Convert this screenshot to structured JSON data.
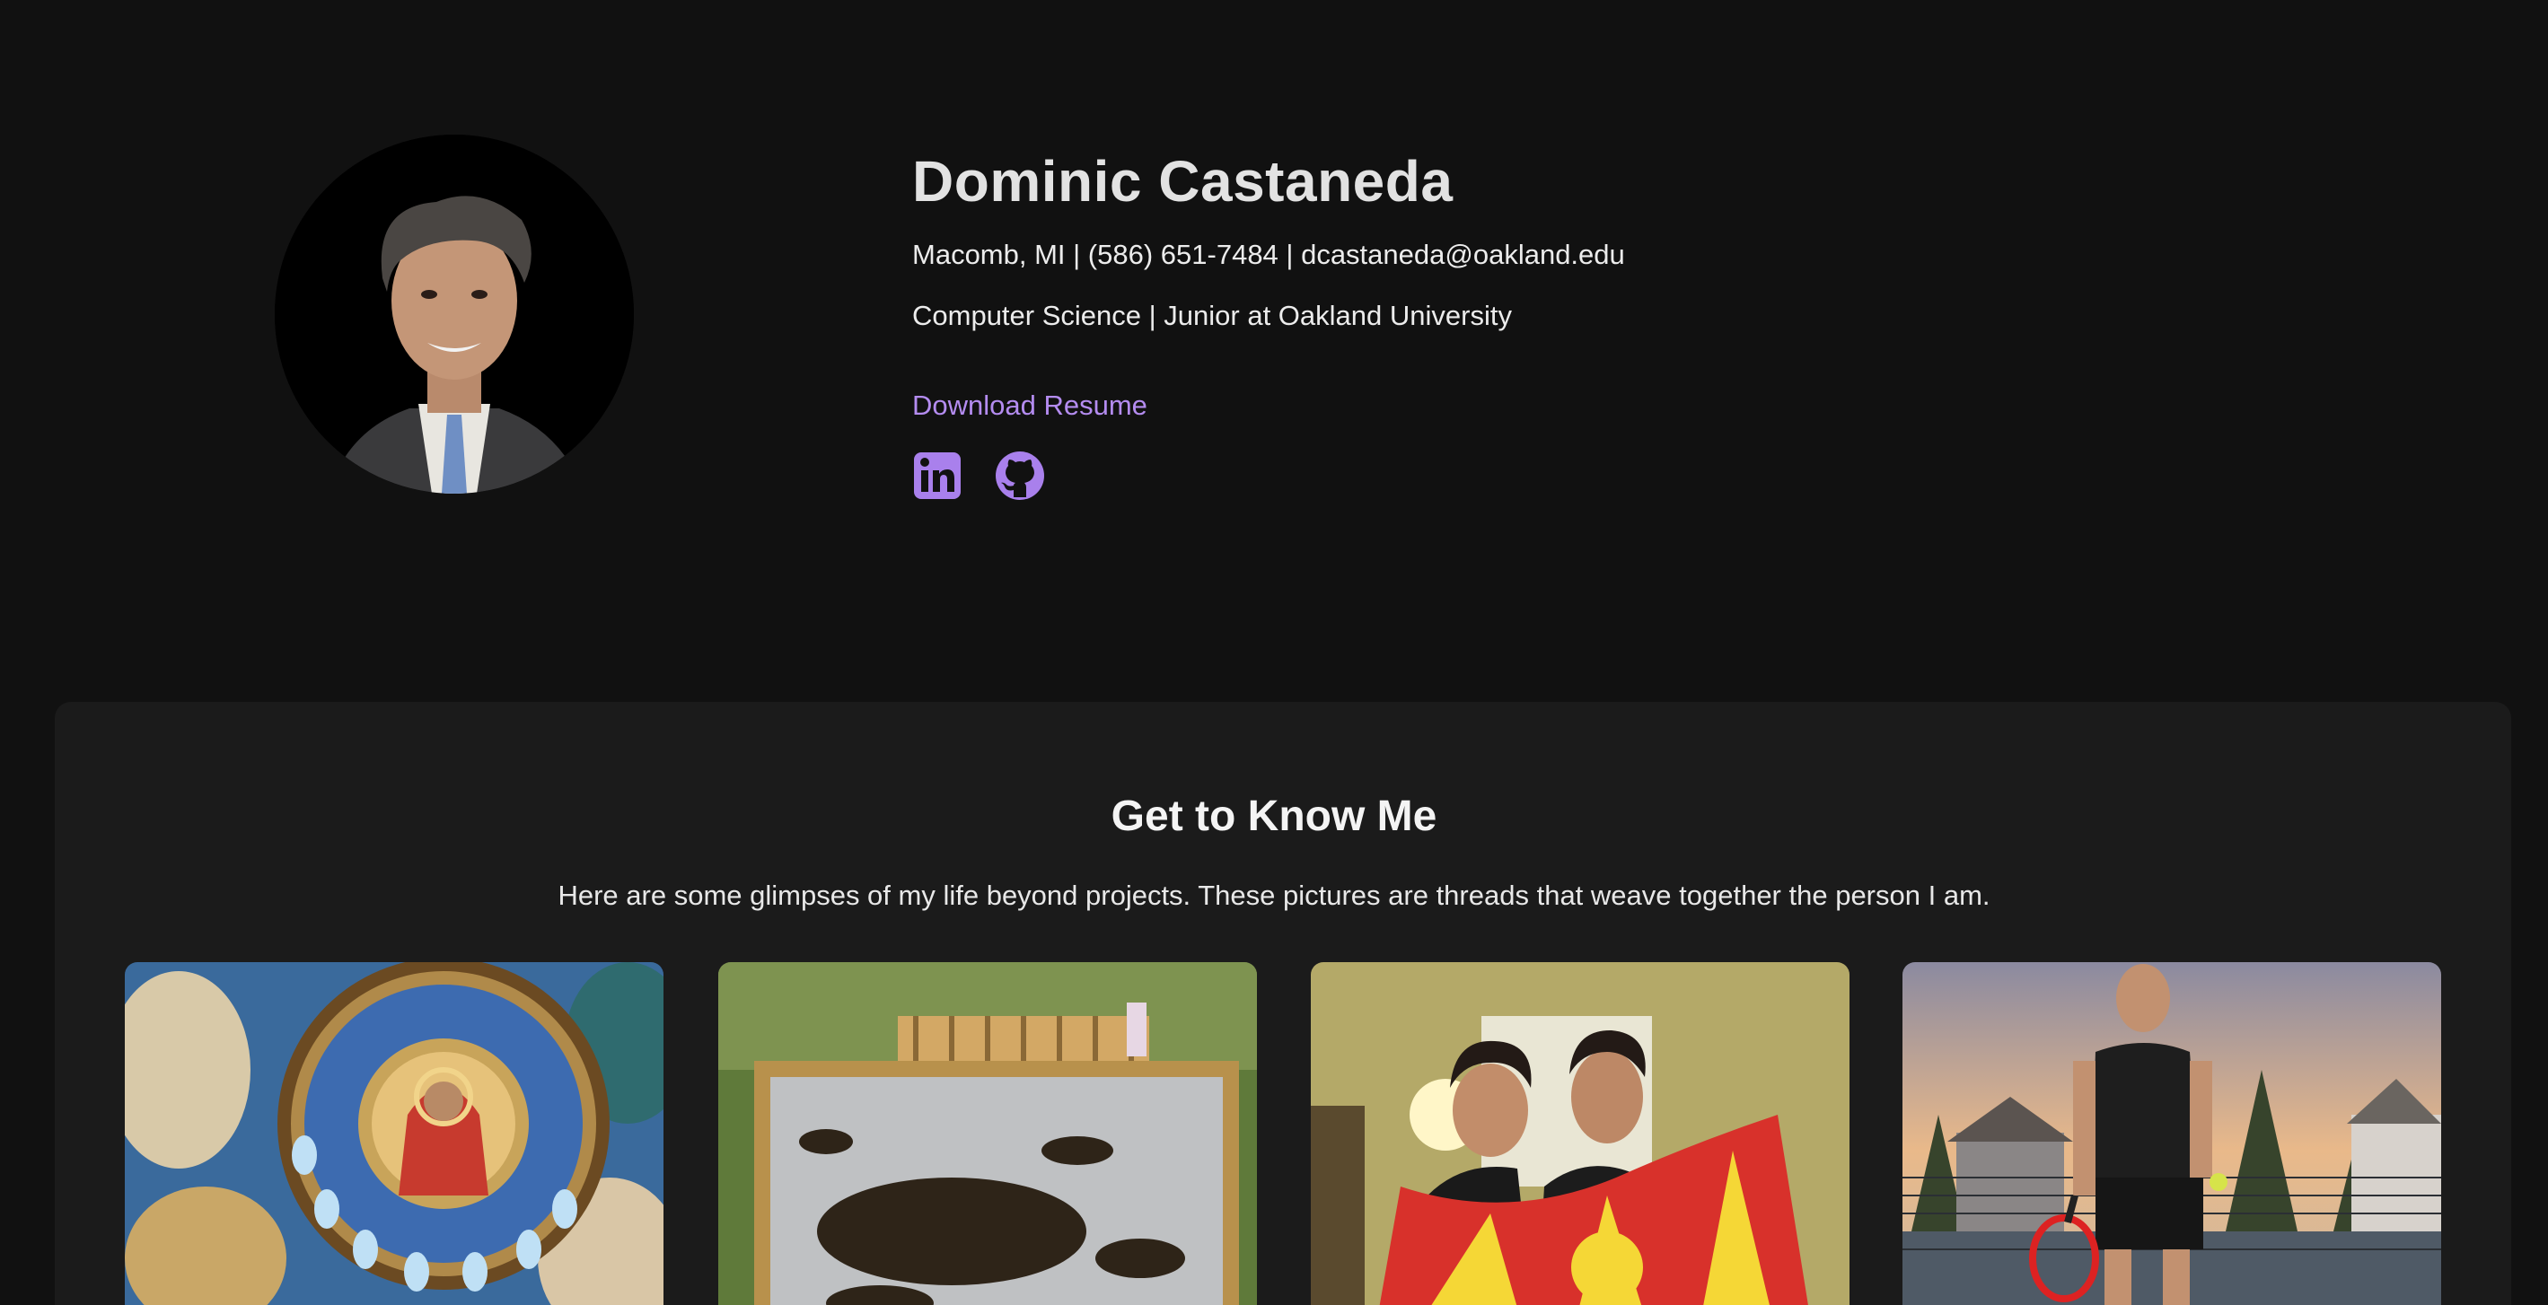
{
  "profile": {
    "name": "Dominic Castaneda",
    "contact_line": "Macomb, MI | (586) 651-7484 | dcastaneda@oakland.edu",
    "study_line": "Computer Science | Junior at Oakland University",
    "resume_link": "Download Resume",
    "socials": [
      {
        "icon": "linkedin-icon"
      },
      {
        "icon": "github-icon"
      }
    ]
  },
  "about": {
    "title": "Get to Know Me",
    "subtitle": "Here are some glimpses of my life beyond projects. These pictures are threads that weave together the person I am.",
    "photos": [
      {
        "subject": "church-dome-icon"
      },
      {
        "subject": "beehive-frame"
      },
      {
        "subject": "friends-with-flag"
      },
      {
        "subject": "tennis-player"
      }
    ]
  },
  "colors": {
    "background": "#111111",
    "card": "#1b1b1b",
    "accent": "#b48cf0",
    "text": "#e4e4e4"
  }
}
